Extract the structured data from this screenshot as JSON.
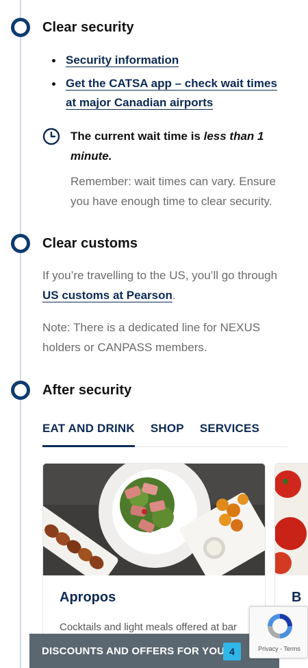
{
  "steps": [
    {
      "title": "Clear security"
    },
    {
      "title": "Clear customs"
    },
    {
      "title": "After security"
    }
  ],
  "security": {
    "links": [
      "Security information",
      "Get the CATSA app – check wait times at major Canadian airports"
    ],
    "wait_prefix": "The current wait time is ",
    "wait_value": "less than 1 minute.",
    "wait_note": "Remember: wait times can vary. Ensure you have enough time to clear security."
  },
  "customs": {
    "text_before": "If you’re travelling to the US, you’ll go through ",
    "link": "US customs at Pearson",
    "text_after": ".",
    "note": "Note: There is a dedicated line for NEXUS holders or CANPASS members."
  },
  "after_security": {
    "tabs": [
      "EAT AND DRINK",
      "SHOP",
      "SERVICES"
    ],
    "active_tab": "EAT AND DRINK",
    "cards": [
      {
        "name": "Apropos",
        "description": "Cocktails and light meals offered at bar"
      },
      {
        "name": "B"
      }
    ]
  },
  "discount_bar": {
    "label": "DISCOUNTS AND OFFERS FOR YOU",
    "count": "4"
  },
  "recaptcha": {
    "links": "Privacy - Terms"
  },
  "colors": {
    "brand_navy": "#0d2a55",
    "marker": "#0d3b6e",
    "badge": "#2fb7e8",
    "bar": "#5b6770"
  },
  "icons": [
    "clock-icon",
    "recaptcha-logo-icon"
  ]
}
